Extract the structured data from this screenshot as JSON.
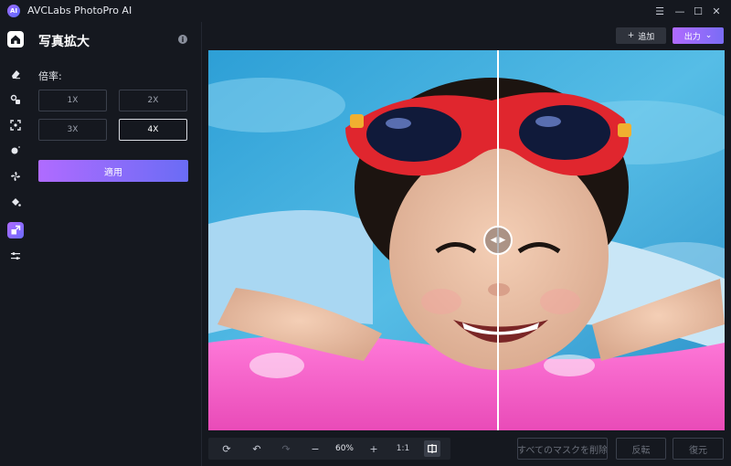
{
  "app": {
    "title": "AVCLabs PhotoPro AI",
    "logo_text": "AI"
  },
  "window_controls": {
    "menu": "☰",
    "minimize": "—",
    "maximize": "☐",
    "close": "✕"
  },
  "rail": [
    {
      "name": "home",
      "icon": "home-icon"
    },
    {
      "name": "eraser",
      "icon": "eraser-icon"
    },
    {
      "name": "replace",
      "icon": "replace-icon"
    },
    {
      "name": "enhance",
      "icon": "enhance-icon"
    },
    {
      "name": "face",
      "icon": "face-icon"
    },
    {
      "name": "background",
      "icon": "background-icon"
    },
    {
      "name": "colorize",
      "icon": "colorize-icon"
    },
    {
      "name": "upscale",
      "icon": "upscale-icon"
    },
    {
      "name": "adjust",
      "icon": "adjust-icon"
    }
  ],
  "panel": {
    "title": "写真拡大",
    "scale_label": "倍率:",
    "scales": [
      "1X",
      "2X",
      "3X",
      "4X"
    ],
    "selected_scale": "4X",
    "apply_label": "適用"
  },
  "header_actions": {
    "add_icon": "+",
    "add_label": "追加",
    "export_label": "出力",
    "export_chevron": "⌄"
  },
  "toolbar": {
    "reset_icon": "⟳",
    "undo_icon": "↶",
    "redo_icon": "↷",
    "zoom_out_icon": "−",
    "zoom_level": "60%",
    "zoom_in_icon": "+",
    "ratio_label": "1:1"
  },
  "footer_actions": {
    "clear_masks_label": "すべてのマスクを削除",
    "invert_label": "反転",
    "restore_label": "復元"
  },
  "colors": {
    "accent_start": "#b06bff",
    "accent_end": "#6a6cf5",
    "background": "#15181f"
  }
}
